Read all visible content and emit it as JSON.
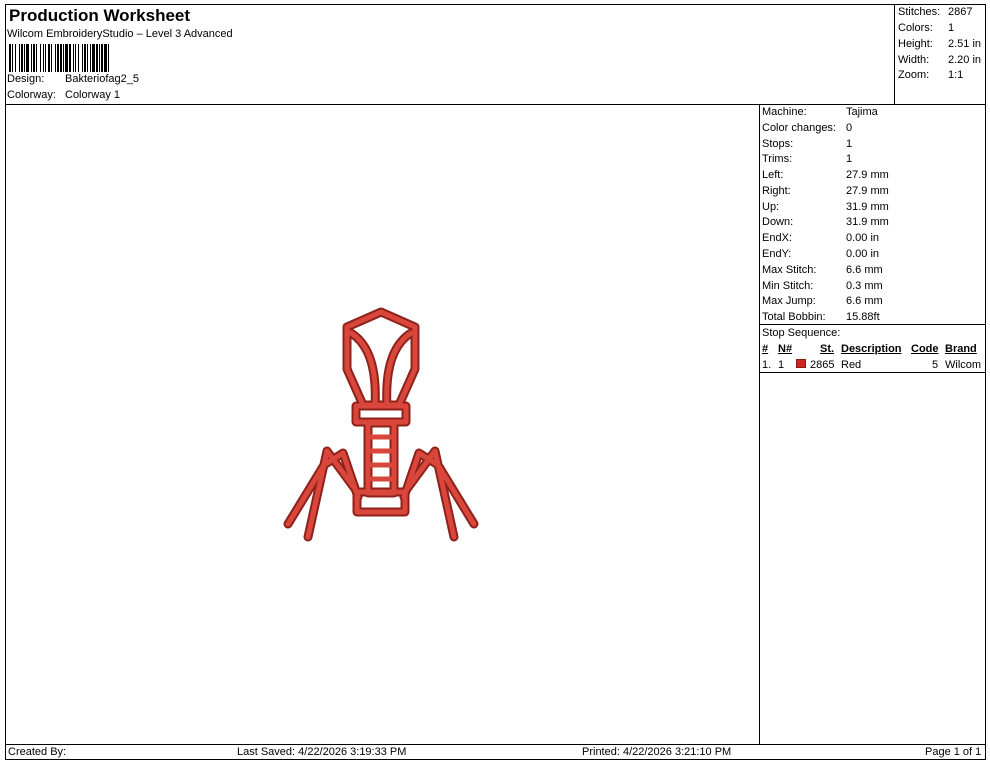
{
  "header": {
    "title": "Production Worksheet",
    "subtitle": "Wilcom EmbroideryStudio – Level 3 Advanced",
    "design_label": "Design:",
    "design_value": "Bakteriofag2_5",
    "colorway_label": "Colorway:",
    "colorway_value": "Colorway 1"
  },
  "summary": [
    {
      "label": "Stitches:",
      "value": "2867"
    },
    {
      "label": "Colors:",
      "value": "1"
    },
    {
      "label": "Height:",
      "value": "2.51 in"
    },
    {
      "label": "Width:",
      "value": "2.20 in"
    },
    {
      "label": "Zoom:",
      "value": "1:1"
    }
  ],
  "info": [
    {
      "label": "Machine:",
      "value": "Tajima"
    },
    {
      "label": "Color changes:",
      "value": "0"
    },
    {
      "label": "Stops:",
      "value": "1"
    },
    {
      "label": "Trims:",
      "value": "1"
    },
    {
      "label": "Left:",
      "value": "27.9 mm"
    },
    {
      "label": "Right:",
      "value": "27.9 mm"
    },
    {
      "label": "Up:",
      "value": "31.9 mm"
    },
    {
      "label": "Down:",
      "value": "31.9 mm"
    },
    {
      "label": "EndX:",
      "value": "0.00 in"
    },
    {
      "label": "EndY:",
      "value": "0.00 in"
    },
    {
      "label": "Max Stitch:",
      "value": "6.6 mm"
    },
    {
      "label": "Min Stitch:",
      "value": "0.3 mm"
    },
    {
      "label": "Max Jump:",
      "value": "6.6 mm"
    },
    {
      "label": "Total Bobbin:",
      "value": "15.88ft"
    }
  ],
  "stop_sequence": {
    "title": "Stop Sequence:",
    "headers": {
      "num": "#",
      "n": "N#",
      "st": "St.",
      "description": "Description",
      "code": "Code",
      "brand": "Brand"
    },
    "rows": [
      {
        "num": "1.",
        "n": "1",
        "color": "#c8281e",
        "st": "2865",
        "description": "Red",
        "code": "5",
        "brand": "Wilcom"
      }
    ]
  },
  "footer": {
    "created_by": "Created By:",
    "last_saved": "Last Saved: 4/22/2026 3:19:33 PM",
    "printed": "Printed: 4/22/2026 3:21:10 PM",
    "page": "Page 1 of 1"
  },
  "design_color": "#c8392e"
}
